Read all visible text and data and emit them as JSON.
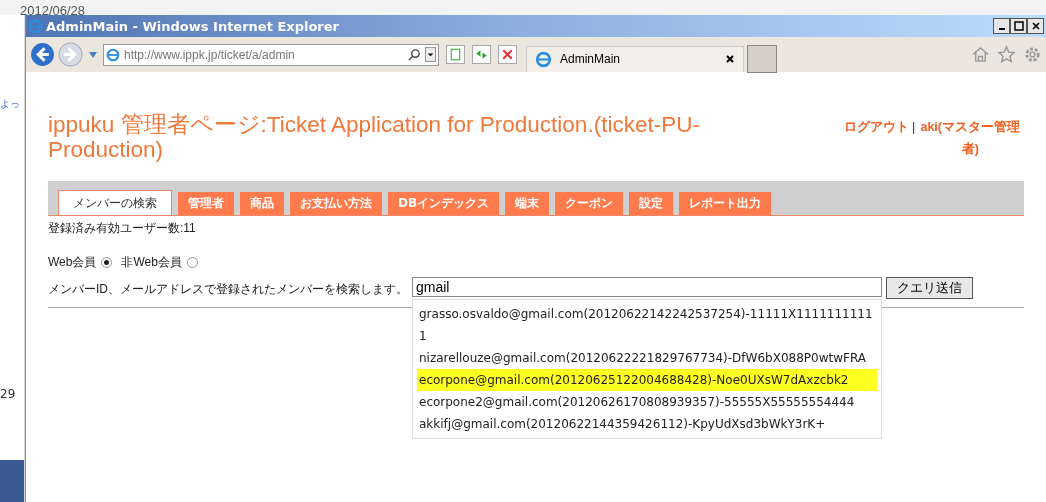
{
  "background": {
    "date": "2012/06/28",
    "snippet": "よっ",
    "number": "29"
  },
  "window": {
    "title": "AdminMain - Windows Internet Explorer"
  },
  "browser": {
    "address": "http://www.ippk.jp/ticket/a/admin",
    "tab": {
      "label": "AdminMain",
      "selected": true
    }
  },
  "page": {
    "title": "ippuku 管理者ページ:Ticket Application for Production.(ticket-PU-Production)",
    "logout": "ログアウト",
    "separator": "|",
    "user": "aki(マスター管理者)",
    "tabs": [
      {
        "label": "メンバーの検索",
        "selected": true
      },
      {
        "label": "管理者",
        "selected": false
      },
      {
        "label": "商品",
        "selected": false
      },
      {
        "label": "お支払い方法",
        "selected": false
      },
      {
        "label": "DBインデックス",
        "selected": false
      },
      {
        "label": "端末",
        "selected": false
      },
      {
        "label": "クーポン",
        "selected": false
      },
      {
        "label": "設定",
        "selected": false
      },
      {
        "label": "レポート出力",
        "selected": false
      }
    ],
    "user_count": "登録済み有効ユーザー数:11",
    "radios": [
      {
        "label": "Web会員",
        "selected": true
      },
      {
        "label": "非Web会員",
        "selected": false
      }
    ],
    "search_label": "メンバーID、メールアドレスで登録されたメンバーを検索します。",
    "search_value": "gmail",
    "submit": "クエリ送信",
    "suggestions": [
      {
        "text": "grasso.osvaldo@gmail.com(20120622142242537254)-11111X11111111111",
        "selected": false
      },
      {
        "text": "nizarellouze@gmail.com(20120622221829767734)-DfW6bX088P0wtwFRA",
        "selected": false
      },
      {
        "text": "ecorpone@gmail.com(20120625122004688428)-Noe0UXsW7dAxzcbk2",
        "selected": true
      },
      {
        "text": "ecorpone2@gmail.com(20120626170808939357)-55555X55555554444",
        "selected": false
      },
      {
        "text": "akkifj@gmail.com(20120622144359426112)-KpyUdXsd3bWkY3rK+",
        "selected": false
      }
    ]
  }
}
